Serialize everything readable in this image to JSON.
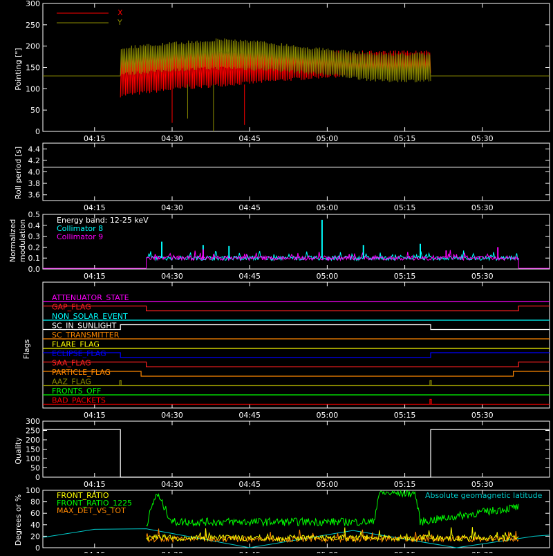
{
  "colors": {
    "background": "#000000",
    "frame": "#ffffff",
    "x_series": "#ff0000",
    "y_series": "#8a8a00",
    "roll_line": "#ffffff",
    "collimator8": "#00ffff",
    "collimator9": "#ff00ff",
    "front_ratio": "#ffff00",
    "front_ratio_1225": "#00ff00",
    "max_det_vs_tot": "#ff8800",
    "geomag": "#00cccc"
  },
  "x_axis": {
    "range": [
      "04:05",
      "05:43"
    ],
    "ticks": [
      "04:15",
      "04:30",
      "04:45",
      "05:00",
      "05:15",
      "05:30"
    ]
  },
  "chart_data": [
    {
      "type": "line",
      "ylabel": "Pointing [\"]",
      "ylim": [
        0,
        300
      ],
      "yticks": [
        0,
        50,
        100,
        150,
        200,
        250,
        300
      ],
      "legend_placement": "top-left",
      "series": [
        {
          "name": "X",
          "x_range": [
            "04:20",
            "05:20"
          ],
          "envelope_low": [
            80,
            95,
            105,
            115,
            125,
            130,
            130
          ],
          "envelope_high": [
            180,
            190,
            190,
            190,
            190,
            190,
            190
          ],
          "baseline_outside": 130
        },
        {
          "name": "Y",
          "x_range": [
            "04:20",
            "05:20"
          ],
          "envelope_low": [
            130,
            140,
            145,
            140,
            130,
            115,
            115
          ],
          "envelope_high": [
            200,
            210,
            220,
            210,
            195,
            185,
            185
          ],
          "baseline_outside": 130
        }
      ]
    },
    {
      "type": "line",
      "ylabel": "Roll period [s]",
      "ylim": [
        3.5,
        4.5
      ],
      "yticks": [
        3.6,
        3.8,
        4.0,
        4.2,
        4.4
      ],
      "series": [
        {
          "name": "",
          "x": [
            "04:05",
            "05:43"
          ],
          "y": [
            4.08,
            4.08
          ]
        }
      ]
    },
    {
      "type": "line",
      "ylabel_lines": [
        "Normalized",
        "modulation"
      ],
      "ylim": [
        0,
        0.5
      ],
      "yticks": [
        0.0,
        0.1,
        0.2,
        0.3,
        0.4,
        0.5
      ],
      "legend": [
        "Energy band: 12-25 keV",
        "Collimator 8",
        "Collimator 9"
      ],
      "active_range": [
        "04:25",
        "05:37"
      ],
      "typical_level": 0.1,
      "spikes": [
        {
          "series": "Collimator 8",
          "x": "04:28",
          "y": 0.25
        },
        {
          "series": "Collimator 8",
          "x": "04:36",
          "y": 0.22
        },
        {
          "series": "Collimator 8",
          "x": "04:41",
          "y": 0.21
        },
        {
          "series": "Collimator 8",
          "x": "04:59",
          "y": 0.45
        },
        {
          "series": "Collimator 8",
          "x": "05:07",
          "y": 0.22
        },
        {
          "series": "Collimator 8",
          "x": "05:18",
          "y": 0.23
        },
        {
          "series": "Collimator 9",
          "x": "04:36",
          "y": 0.18
        },
        {
          "series": "Collimator 9",
          "x": "05:23",
          "y": 0.17
        },
        {
          "series": "Collimator 9",
          "x": "05:33",
          "y": 0.2
        }
      ]
    },
    {
      "type": "flags",
      "ylabel": "Flags",
      "flags": [
        {
          "name": "ATTENUATOR_STATE",
          "color": "#ff00ff",
          "segments": []
        },
        {
          "name": "GAP_FLAG",
          "color": "#ff2020",
          "segments": [
            [
              "04:05",
              "04:25",
              1
            ],
            [
              "04:25",
              "05:37",
              0
            ],
            [
              "05:37",
              "05:43",
              1
            ]
          ]
        },
        {
          "name": "NON_SOLAR_EVENT",
          "color": "#00ffff",
          "segments": []
        },
        {
          "name": "SC_IN_SUNLIGHT",
          "color": "#ffffff",
          "segments": [
            [
              "04:05",
              "04:20",
              0
            ],
            [
              "04:20",
              "05:20",
              1
            ],
            [
              "05:20",
              "05:43",
              0
            ]
          ]
        },
        {
          "name": "SC_TRANSMITTER",
          "color": "#ff8800",
          "segments": []
        },
        {
          "name": "FLARE_FLAG",
          "color": "#ffff00",
          "segments": []
        },
        {
          "name": "ECLIPSE_FLAG",
          "color": "#0000ff",
          "segments": [
            [
              "04:05",
              "04:20",
              1
            ],
            [
              "04:20",
              "05:20",
              0
            ],
            [
              "05:20",
              "05:43",
              1
            ]
          ]
        },
        {
          "name": "SAA_FLAG",
          "color": "#ff2020",
          "segments": [
            [
              "04:05",
              "04:25",
              1
            ],
            [
              "04:25",
              "05:37",
              0
            ],
            [
              "05:37",
              "05:43",
              1
            ]
          ]
        },
        {
          "name": "PARTICLE_FLAG",
          "color": "#ff8800",
          "segments": [
            [
              "04:05",
              "04:24",
              1
            ],
            [
              "04:24",
              "05:36",
              0
            ],
            [
              "05:36",
              "05:43",
              1
            ]
          ]
        },
        {
          "name": "AAZ_FLAG",
          "color": "#8a8a00",
          "segments": [],
          "pulses": [
            "04:20",
            "05:20"
          ]
        },
        {
          "name": "FRONTS_OFF",
          "color": "#00ff00",
          "segments": []
        },
        {
          "name": "BAD_PACKETS",
          "color": "#ff0000",
          "segments": [],
          "pulses": [
            "05:20"
          ]
        }
      ]
    },
    {
      "type": "line",
      "ylabel": "Quality",
      "ylim": [
        0,
        300
      ],
      "yticks": [
        0,
        50,
        100,
        150,
        200,
        250,
        300
      ],
      "series": [
        {
          "name": "",
          "x": [
            "04:05",
            "04:20",
            "04:20",
            "05:20",
            "05:20",
            "05:43"
          ],
          "y": [
            255,
            255,
            0,
            0,
            255,
            255
          ]
        }
      ]
    },
    {
      "type": "line",
      "ylabel": "Degrees or %",
      "ylim": [
        0,
        100
      ],
      "yticks": [
        0,
        20,
        40,
        60,
        80,
        100
      ],
      "legend": [
        "FRONT_RATIO",
        "FRONT_RATIO_1225",
        "MAX_DET_VS_TOT"
      ],
      "annotation": "Absolute geomagnetic latitude",
      "series": [
        {
          "name": "FRONT_RATIO",
          "active_range": [
            "04:25",
            "05:37"
          ],
          "typical_level": 17
        },
        {
          "name": "FRONT_RATIO_1225",
          "active_range": [
            "04:25",
            "05:37"
          ],
          "x": [
            "04:25",
            "04:27",
            "04:30",
            "04:45",
            "05:00",
            "05:09",
            "05:10",
            "05:17",
            "05:18",
            "05:36",
            "05:37"
          ],
          "y": [
            40,
            95,
            45,
            45,
            45,
            45,
            95,
            95,
            45,
            70,
            70
          ]
        },
        {
          "name": "MAX_DET_VS_TOT",
          "active_range": [
            "04:25",
            "05:37"
          ],
          "typical_level": 15
        },
        {
          "name": "Absolute geomagnetic latitude",
          "x": [
            "04:05",
            "04:15",
            "04:25",
            "04:45",
            "05:05",
            "05:25",
            "05:40",
            "05:43"
          ],
          "y": [
            18,
            32,
            33,
            0,
            30,
            0,
            20,
            22
          ]
        }
      ]
    }
  ]
}
